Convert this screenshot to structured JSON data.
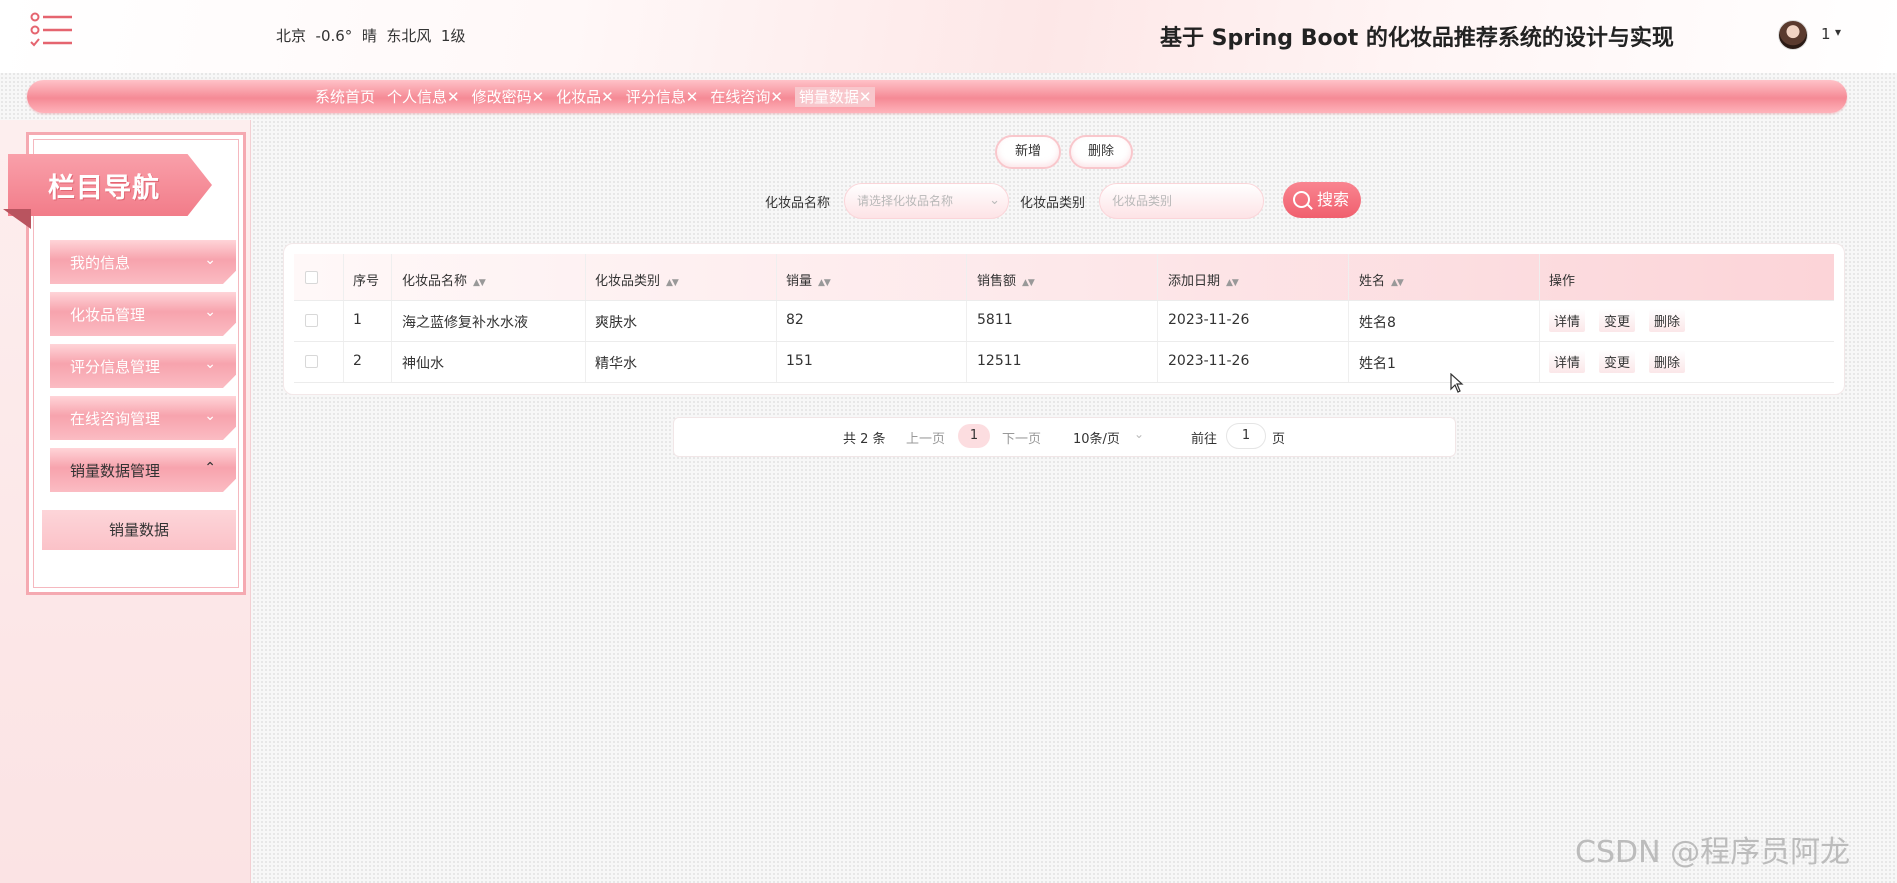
{
  "header": {
    "weather": "北京  -0.6°  晴  东北风  1级",
    "title": "基于 Spring Boot 的化妆品推荐系统的设计与实现",
    "user": "1",
    "user_caret": "▾"
  },
  "tabs": [
    {
      "label": "系统首页"
    },
    {
      "label": "个人信息✕"
    },
    {
      "label": "修改密码✕"
    },
    {
      "label": "化妆品✕"
    },
    {
      "label": "评分信息✕"
    },
    {
      "label": "在线咨询✕"
    },
    {
      "label": "销量数据✕"
    }
  ],
  "sidebar": {
    "banner": "栏目导航",
    "items": [
      {
        "label": "我的信息",
        "chevron": "⌄"
      },
      {
        "label": "化妆品管理",
        "chevron": "⌄"
      },
      {
        "label": "评分信息管理",
        "chevron": "⌄"
      },
      {
        "label": "在线咨询管理",
        "chevron": "⌄"
      },
      {
        "label": "销量数据管理",
        "chevron": "⌃"
      }
    ],
    "sub_item": "销量数据"
  },
  "actions": {
    "add": "新增",
    "delete": "删除"
  },
  "search": {
    "name_label": "化妆品名称",
    "name_placeholder": "请选择化妆品名称",
    "name_caret": "⌄",
    "type_label": "化妆品类别",
    "type_placeholder": "化妆品类别",
    "button": "搜索"
  },
  "table": {
    "columns": [
      "序号",
      "化妆品名称",
      "化妆品类别",
      "销量",
      "销售额",
      "添加日期",
      "姓名",
      "操作"
    ],
    "sort_icon": "▲▼",
    "rows": [
      {
        "no": "1",
        "name": "海之蓝修复补水水液",
        "type": "爽肤水",
        "qty": "82",
        "amount": "5811",
        "date": "2023-11-26",
        "person": "姓名8"
      },
      {
        "no": "2",
        "name": "神仙水",
        "type": "精华水",
        "qty": "151",
        "amount": "12511",
        "date": "2023-11-26",
        "person": "姓名1"
      }
    ],
    "ops": {
      "detail": "详情",
      "change": "变更",
      "delete": "删除"
    }
  },
  "pagination": {
    "total": "共 2 条",
    "prev": "上一页",
    "current": "1",
    "next": "下一页",
    "page_size": "10条/页",
    "size_caret": "⌄",
    "goto": "前往",
    "goto_value": "1",
    "page_unit": "页"
  },
  "watermark": "CSDN @程序员阿龙",
  "colors": {
    "accent": "#f27c89",
    "search_button": "#f05f6e",
    "tab_bar": "#f58a95"
  }
}
